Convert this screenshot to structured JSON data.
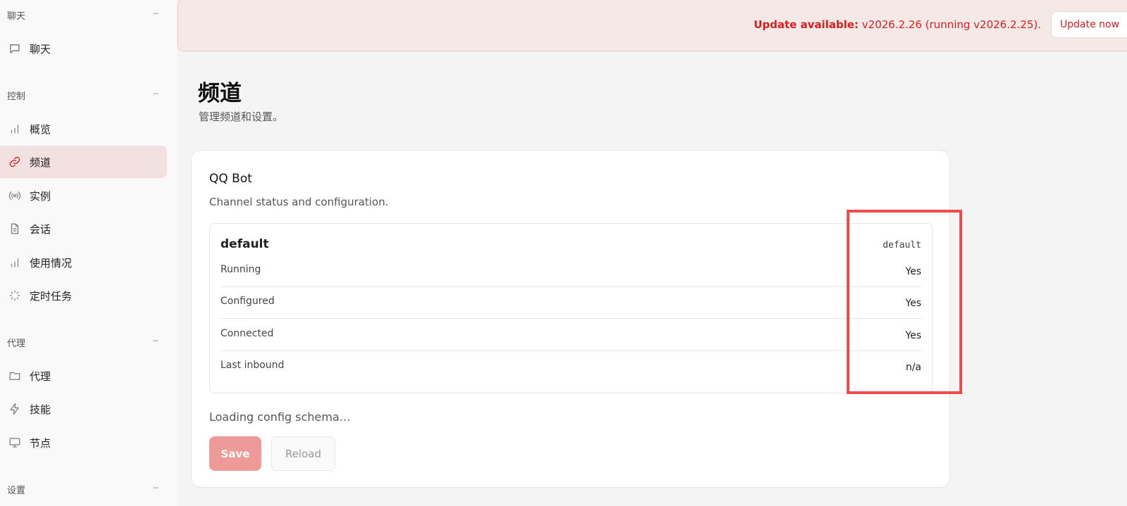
{
  "sidebar": {
    "sections": [
      {
        "title": "聊天",
        "collapse": "−"
      },
      {
        "title": "控制",
        "collapse": "−"
      },
      {
        "title": "代理",
        "collapse": "−"
      },
      {
        "title": "设置",
        "collapse": "−"
      }
    ],
    "items": [
      {
        "label": "聊天",
        "icon": "chat-bubble-icon"
      },
      {
        "label": "概览",
        "icon": "bar-chart-icon"
      },
      {
        "label": "频道",
        "icon": "link-icon",
        "active": true
      },
      {
        "label": "实例",
        "icon": "broadcast-icon"
      },
      {
        "label": "会话",
        "icon": "document-icon"
      },
      {
        "label": "使用情况",
        "icon": "bar-chart-icon"
      },
      {
        "label": "定时任务",
        "icon": "loader-icon"
      },
      {
        "label": "代理",
        "icon": "folder-icon"
      },
      {
        "label": "技能",
        "icon": "lightning-icon"
      },
      {
        "label": "节点",
        "icon": "monitor-icon"
      }
    ]
  },
  "banner": {
    "label": "Update available:",
    "message": "v2026.2.26 (running v2026.2.25).",
    "button_label": "Update now"
  },
  "page": {
    "title": "频道",
    "subtitle": "管理频道和设置。"
  },
  "card": {
    "title": "QQ Bot",
    "description": "Channel status and configuration.",
    "account": {
      "name": "default",
      "id": "default",
      "rows": [
        {
          "label": "Running",
          "value": "Yes"
        },
        {
          "label": "Configured",
          "value": "Yes"
        },
        {
          "label": "Connected",
          "value": "Yes"
        },
        {
          "label": "Last inbound",
          "value": "n/a"
        }
      ]
    },
    "loading_text": "Loading config schema…",
    "save_label": "Save",
    "reload_label": "Reload"
  },
  "colors": {
    "accent": "#d81e1e",
    "active_nav_bg": "#f3e1e1",
    "save_button_bg": "#ee9a98",
    "highlight_border": "#ee4c4c"
  }
}
